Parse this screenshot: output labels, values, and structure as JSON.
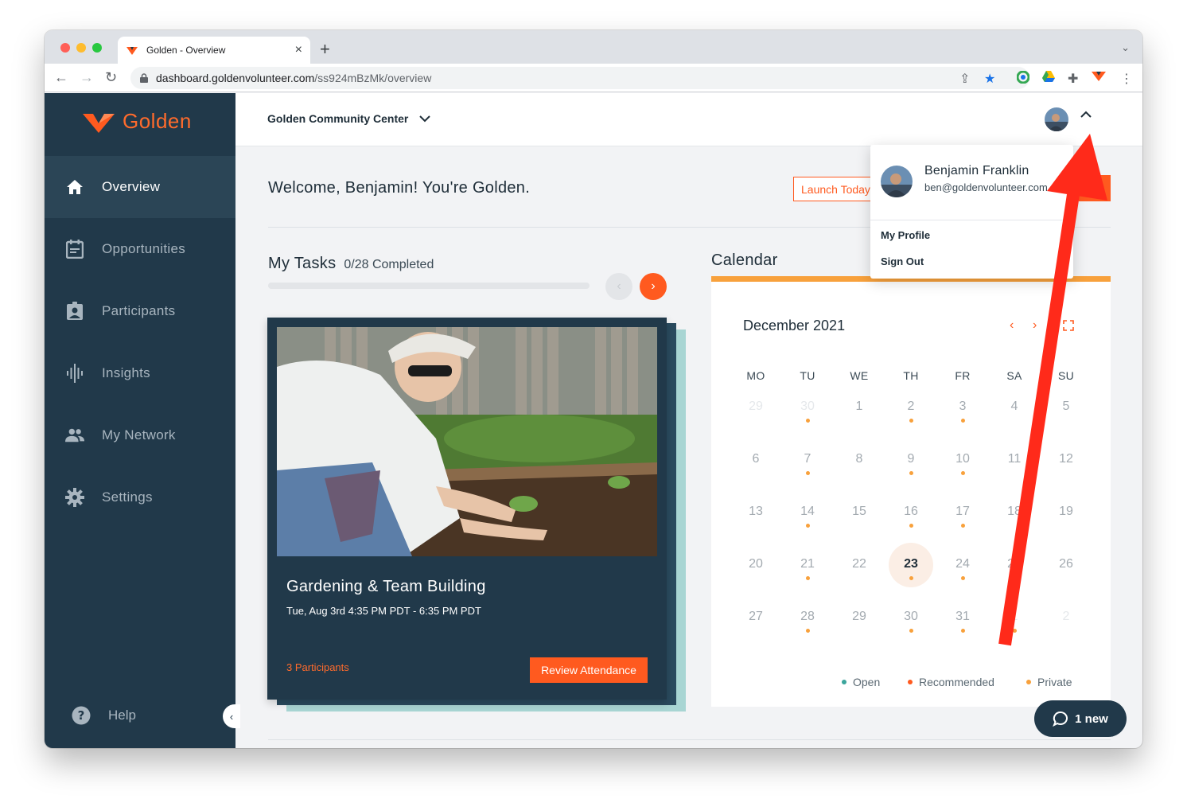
{
  "browser": {
    "tab_title": "Golden - Overview",
    "url_host": "dashboard.goldenvolunteer.com",
    "url_path": "/ss924mBzMk/overview"
  },
  "sidebar": {
    "brand": "Golden",
    "items": [
      {
        "label": "Overview",
        "icon": "home-icon",
        "active": true
      },
      {
        "label": "Opportunities",
        "icon": "calendar-icon",
        "active": false
      },
      {
        "label": "Participants",
        "icon": "badge-icon",
        "active": false
      },
      {
        "label": "Insights",
        "icon": "waveform-icon",
        "active": false
      },
      {
        "label": "My Network",
        "icon": "people-icon",
        "active": false
      },
      {
        "label": "Settings",
        "icon": "gear-icon",
        "active": false
      }
    ],
    "help_label": "Help"
  },
  "header": {
    "org_name": "Golden Community Center"
  },
  "main": {
    "welcome": "Welcome, Benjamin! You're Golden.",
    "launch_button": "Launch Today's",
    "tasks": {
      "title": "My Tasks",
      "count": "0/28 Completed",
      "progress": 0
    },
    "task_card": {
      "name": "Gardening & Team Building",
      "time": "Tue, Aug 3rd 4:35 PM PDT - 6:35 PM PDT",
      "participants": "3 Participants",
      "button": "Review Attendance"
    },
    "calendar": {
      "title": "Calendar",
      "month": "December 2021",
      "weekdays": [
        "MO",
        "TU",
        "WE",
        "TH",
        "FR",
        "SA",
        "SU"
      ],
      "weeks": [
        [
          {
            "d": "29",
            "m": true,
            "dot": false
          },
          {
            "d": "30",
            "m": true,
            "dot": true
          },
          {
            "d": "1",
            "dot": false
          },
          {
            "d": "2",
            "dot": true
          },
          {
            "d": "3",
            "dot": true
          },
          {
            "d": "4",
            "dot": false
          },
          {
            "d": "5",
            "dot": false
          }
        ],
        [
          {
            "d": "6",
            "dot": false
          },
          {
            "d": "7",
            "dot": true
          },
          {
            "d": "8",
            "dot": false
          },
          {
            "d": "9",
            "dot": true
          },
          {
            "d": "10",
            "dot": true
          },
          {
            "d": "11",
            "dot": false
          },
          {
            "d": "12",
            "dot": false
          }
        ],
        [
          {
            "d": "13",
            "dot": false
          },
          {
            "d": "14",
            "dot": true
          },
          {
            "d": "15",
            "dot": false
          },
          {
            "d": "16",
            "dot": true
          },
          {
            "d": "17",
            "dot": true
          },
          {
            "d": "18",
            "dot": false
          },
          {
            "d": "19",
            "dot": false
          }
        ],
        [
          {
            "d": "20",
            "dot": false
          },
          {
            "d": "21",
            "dot": true
          },
          {
            "d": "22",
            "dot": false
          },
          {
            "d": "23",
            "dot": true,
            "today": true
          },
          {
            "d": "24",
            "dot": true
          },
          {
            "d": "25",
            "dot": false
          },
          {
            "d": "26",
            "dot": false
          }
        ],
        [
          {
            "d": "27",
            "dot": false
          },
          {
            "d": "28",
            "dot": true
          },
          {
            "d": "29",
            "dot": false
          },
          {
            "d": "30",
            "dot": true
          },
          {
            "d": "31",
            "dot": true
          },
          {
            "d": "1",
            "m": true,
            "dot": true
          },
          {
            "d": "2",
            "m": true,
            "dot": false
          }
        ]
      ],
      "legend": [
        {
          "label": "Open",
          "color": "#3ba59c"
        },
        {
          "label": "Recommended",
          "color": "#ff5a1f"
        },
        {
          "label": "Private",
          "color": "#f8a13c"
        }
      ]
    }
  },
  "profile_menu": {
    "name": "Benjamin Franklin",
    "email": "ben@goldenvolunteer.com",
    "items": [
      "My Profile",
      "Sign Out"
    ]
  },
  "chat": {
    "label": "1 new"
  },
  "colors": {
    "accent": "#ff5a1f",
    "sidebar": "#21394a",
    "calendar_accent": "#f8a13c",
    "annotation": "#ff2a1a"
  }
}
